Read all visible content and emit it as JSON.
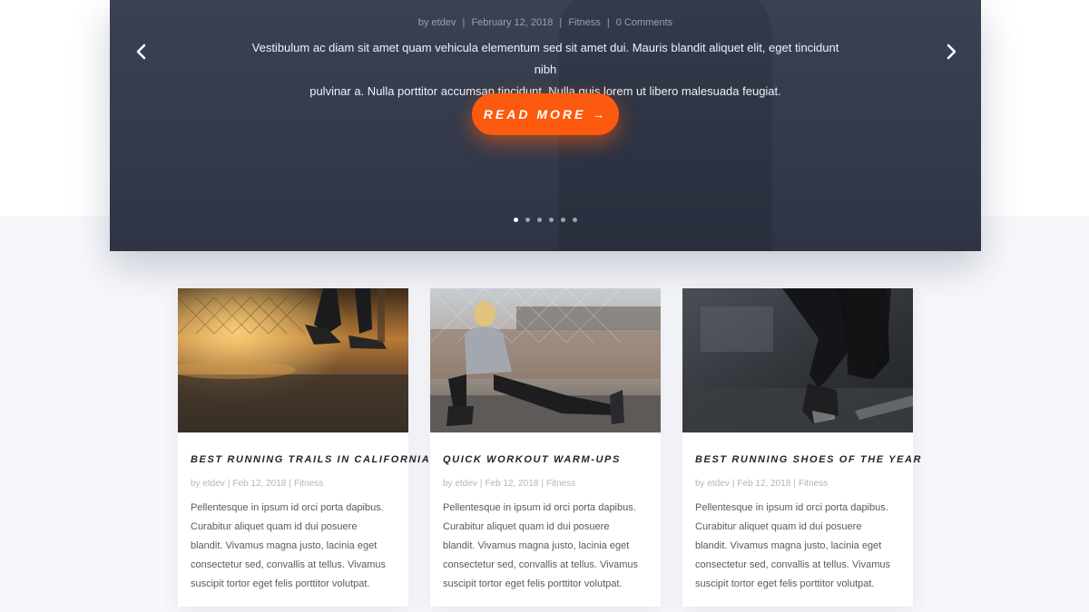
{
  "hero": {
    "title_fragment": "",
    "meta": {
      "author": "by etdev",
      "date": "February 12, 2018",
      "category": "Fitness",
      "comments": "0 Comments",
      "separator": "|"
    },
    "excerpt_lines": [
      "Vestibulum ac diam sit amet quam vehicula elementum sed sit amet dui. Mauris blandit aliquet elit, eget tincidunt nibh",
      "pulvinar a. Nulla porttitor accumsan tincidunt. Nulla quis lorem ut libero malesuada feugiat."
    ],
    "button_label": "READ MORE →",
    "prev_icon": "chevron-left-icon",
    "next_icon": "chevron-right-icon",
    "slide_count": 6,
    "active_slide": 1,
    "colors": {
      "background": "#363d4e",
      "button": "#fb5a0f",
      "text": "#f0f2f6"
    }
  },
  "posts": [
    {
      "title": "BEST RUNNING TRAILS IN CALIFORNIA",
      "author": "by etdev",
      "date": "Feb 12, 2018",
      "category": "Fitness",
      "separator": "|",
      "excerpt_lines": [
        "Pellentesque in ipsum id orci porta dapibus.",
        "Curabitur aliquet quam id dui posuere",
        "blandit. Vivamus magna justo, lacinia eget",
        "consectetur sed, convallis at tellus. Vivamus",
        "suscipit tortor eget felis porttitor volutpat."
      ]
    },
    {
      "title": "QUICK WORKOUT WARM-UPS",
      "author": "by etdev",
      "date": "Feb 12, 2018",
      "category": "Fitness",
      "separator": "|",
      "excerpt_lines": [
        "Pellentesque in ipsum id orci porta dapibus.",
        "Curabitur aliquet quam id dui posuere",
        "blandit. Vivamus magna justo, lacinia eget",
        "consectetur sed, convallis at tellus. Vivamus",
        "suscipit tortor eget felis porttitor volutpat."
      ]
    },
    {
      "title": "BEST RUNNING SHOES OF THE YEAR",
      "author": "by etdev",
      "date": "Feb 12, 2018",
      "category": "Fitness",
      "separator": "|",
      "excerpt_lines": [
        "Pellentesque in ipsum id orci porta dapibus.",
        "Curabitur aliquet quam id dui posuere",
        "blandit. Vivamus magna justo, lacinia eget",
        "consectetur sed, convallis at tellus. Vivamus",
        "suscipit tortor eget felis porttitor volutpat."
      ]
    }
  ]
}
